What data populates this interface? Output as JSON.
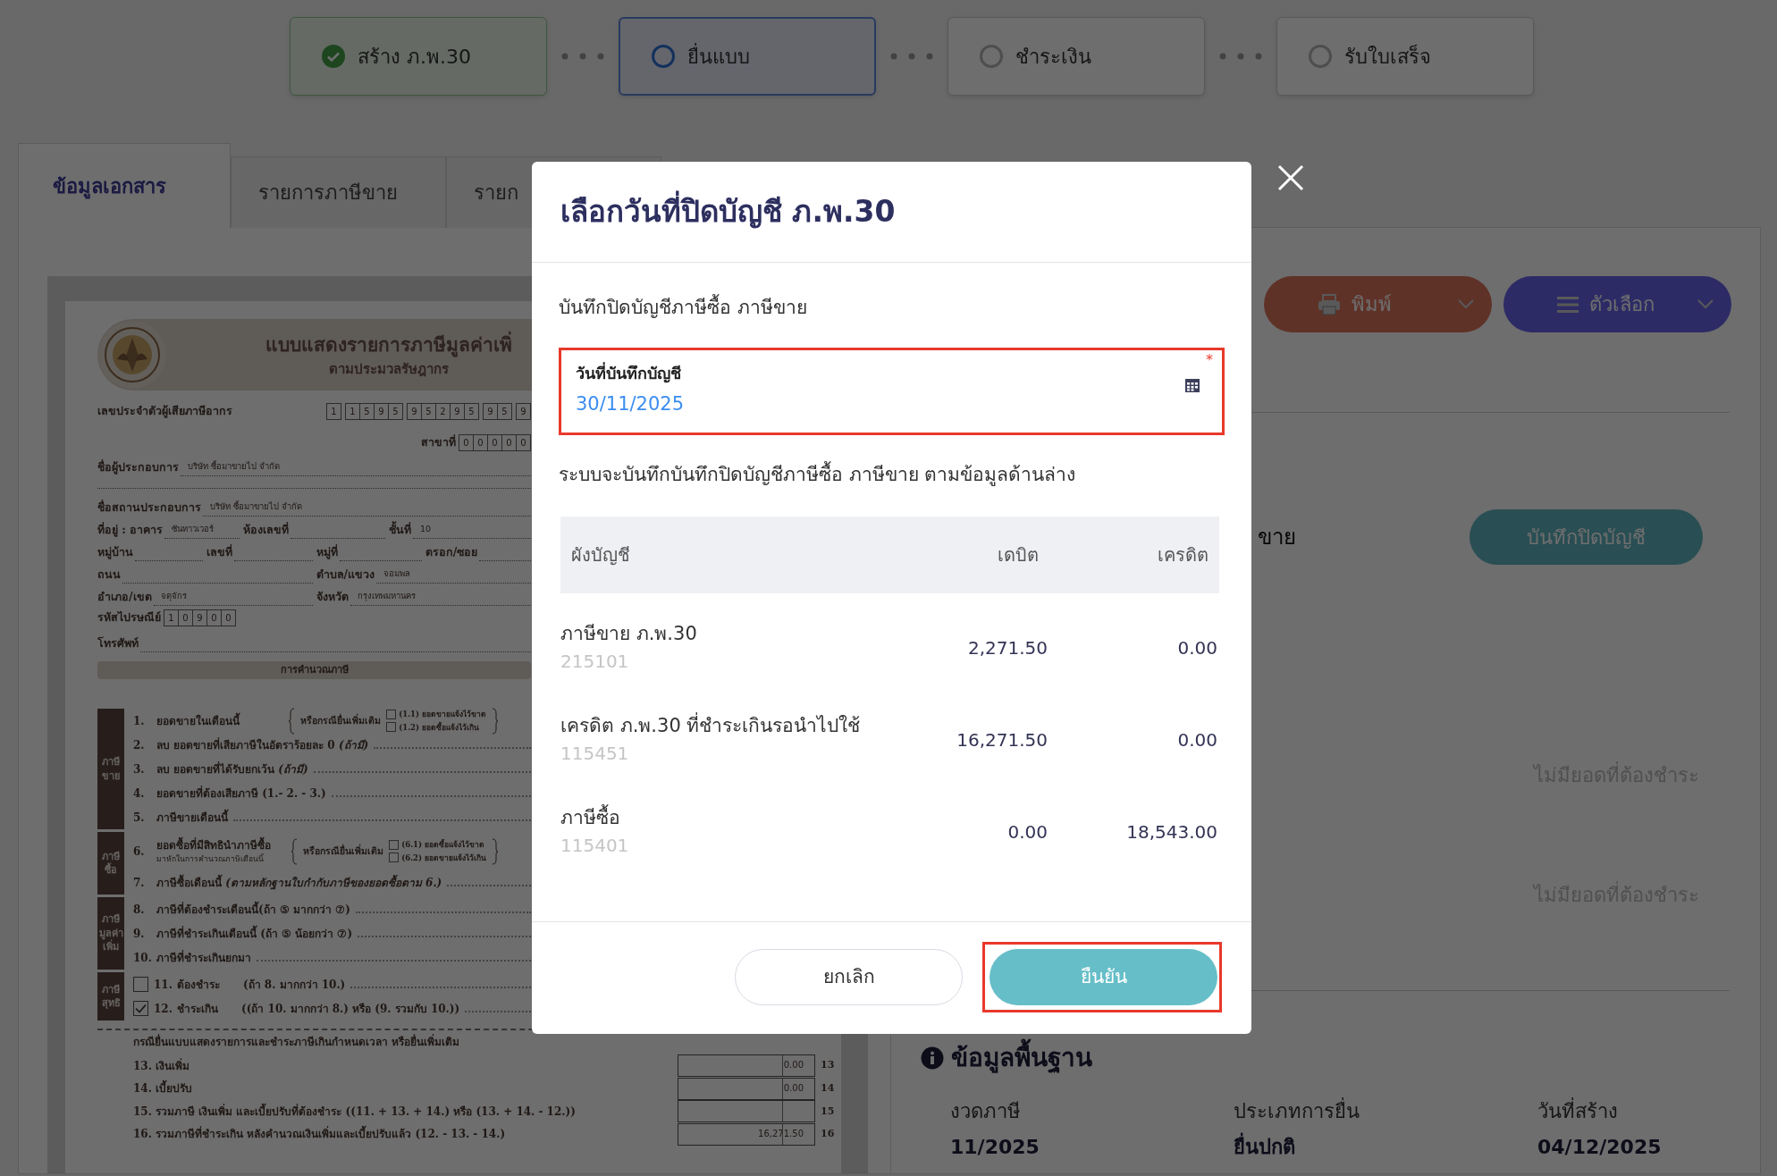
{
  "steps": [
    {
      "label": "สร้าง ภ.พ.30",
      "completed": true,
      "selected": false
    },
    {
      "label": "ยื่นแบบ",
      "completed": false,
      "selected": true
    },
    {
      "label": "ชำระเงิน",
      "completed": false,
      "selected": false
    },
    {
      "label": "รับใบเสร็จ",
      "completed": false,
      "selected": false
    }
  ],
  "tabs": [
    {
      "label": "ข้อมูลเอกสาร",
      "selected": true
    },
    {
      "label": "รายการภาษีขาย",
      "selected": false
    },
    {
      "label": "รายก",
      "selected": false
    }
  ],
  "document": {
    "title": "แบบแสดงรายการภาษีมูลค่าเพิ่",
    "subtitle": "ตามประมวลรัษฎากร",
    "tax_id": {
      "label": "เลขประจำตัวผู้เสียภาษีอากร",
      "groups": [
        [
          "1"
        ],
        [
          "1",
          "5",
          "9",
          "5"
        ],
        [
          "9",
          "5",
          "2",
          "9",
          "5"
        ],
        [
          "9",
          "5"
        ],
        [
          "9"
        ]
      ]
    },
    "branch": {
      "label": "สาขาที่",
      "digits": [
        "0",
        "0",
        "0",
        "0",
        "0"
      ]
    },
    "rows_1": [
      [
        {
          "label": "ชื่อผู้ประกอบการ",
          "value": "บริษัท ซื้อมาขายไป จำกัด"
        }
      ],
      [
        {
          "label": "ชื่อสถานประกอบการ",
          "value": "บริษัท ซื้อมาขายไป จำกัด"
        }
      ],
      [
        {
          "label": "ที่อยู่ : อาคาร",
          "value": "ซันทาวเวอร์"
        },
        {
          "label": "ห้องเลขที่"
        },
        {
          "label": "ชั้นที่",
          "value": "10"
        }
      ],
      [
        {
          "label": "หมู่บ้าน"
        },
        {
          "label": "เลขที่"
        },
        {
          "label": "หมู่ที่"
        },
        {
          "label": "ตรอก/ซอย"
        }
      ],
      [
        {
          "label": "ถนน"
        },
        {
          "label": "ตำบล/แขวง",
          "value": "จอมพล"
        }
      ],
      [
        {
          "label": "อำเภอ/เขต",
          "value": "จตุจักร"
        },
        {
          "label": "จังหวัด",
          "value": "กรุงเทพมหานคร"
        }
      ]
    ],
    "postcode": {
      "label": "รหัสไปรษณีย์",
      "digits": [
        "1",
        "0",
        "9",
        "0",
        "0"
      ]
    },
    "phone": {
      "label": "โทรศัพท์"
    },
    "section": "การคำนวณภาษี",
    "groups": [
      {
        "label": [
          "ภาษี",
          "ขาย"
        ],
        "items": [
          {
            "no": "1.",
            "text": "ยอดขายในเดือนนี้",
            "note": "หรือกรณียื่นเพิ่มเติม",
            "options": [
              {
                "label": "(1.1) ยอดขายแจ้งไว้ขาด",
                "checked": false
              },
              {
                "label": "(1.2) ยอดซื้อแจ้งไว้เกิน",
                "checked": false
              }
            ]
          },
          {
            "no": "2.",
            "text": "ลบ ยอดขายที่เสียภาษีในอัตราร้อยละ 0 *(ถ้ามี)*"
          },
          {
            "no": "3.",
            "text": "ลบ ยอดขายที่ได้รับยกเว้น *(ถ้ามี)*"
          },
          {
            "no": "4.",
            "text": "ยอดขายที่ต้องเสียภาษี (1.- 2. - 3.)"
          },
          {
            "no": "5.",
            "text": "ภาษีขายเดือนนี้"
          }
        ]
      },
      {
        "label": [
          "ภาษี",
          "ซื้อ"
        ],
        "items": [
          {
            "no": "6.",
            "text": "ยอดซื้อที่มีสิทธินำภาษีซื้อ",
            "subtext": "มาหักในการคำนวณภาษีเดือนนี้",
            "note": "หรือกรณียื่นเพิ่มเติม",
            "options": [
              {
                "label": "(6.1) ยอดซื้อแจ้งไว้ขาด",
                "checked": false
              },
              {
                "label": "(6.2) ยอดขายแจ้งไว้เกิน",
                "checked": false
              }
            ]
          },
          {
            "no": "7.",
            "text": "ภาษีซื้อเดือนนี้ *(ตามหลักฐานใบกำกับภาษีของยอดซื้อตาม 6.)*"
          }
        ]
      },
      {
        "label": [
          "ภาษี",
          "มูลค่า",
          "เพิ่ม"
        ],
        "items": [
          {
            "no": "8.",
            "text": "ภาษีที่ต้องชำระเดือนนี้(ถ้า ⑤ มากกว่า ⑦)"
          },
          {
            "no": "9.",
            "text": "ภาษีที่ชำระเกินเดือนนี้ (ถ้า ⑤ น้อยกว่า ⑦)"
          },
          {
            "no": "10.",
            "text": "ภาษีที่ชำระเกินยกมา"
          }
        ]
      },
      {
        "label": [
          "ภาษี",
          "สุทธิ"
        ],
        "items": [
          {
            "no": "11.",
            "text": "ต้องชำระ",
            "condition": "(ถ้า 8. มากกว่า 10.)",
            "kind": "check",
            "checked": false
          },
          {
            "no": "12.",
            "text": "ชำระเกิน",
            "condition": "((ถ้า 10. มากกว่า 8.) หรือ (9. รวมกับ 10.))",
            "kind": "check",
            "checked": true
          }
        ]
      }
    ],
    "late_title": "กรณียื่นแบบแสดงรายการและชำระภาษีเกินกำหนดเวลา หรือยื่นเพิ่มเติม",
    "late_items": [
      {
        "no": "13.",
        "text": "เงินเพิ่ม",
        "amount": "0.00",
        "box_no": "13",
        "kind": "sub"
      },
      {
        "no": "14.",
        "text": "เบี้ยปรับ",
        "amount": "0.00",
        "box_no": "14",
        "kind": "sub"
      },
      {
        "no": "15.",
        "text": "รวมภาษี เงินเพิ่ม และเบี้ยปรับที่ต้องชำระ ((11. + 13. + 14.) หรือ (13. + 14. - 12.))",
        "box_no": "15",
        "kind": "total"
      },
      {
        "no": "16.",
        "text": "รวมภาษีที่ชำระเกิน หลังคำนวณเงินเพิ่มและเบี้ยปรับแล้ว (12. - 13. - 14.)",
        "amount": "16,271.50",
        "box_no": "16",
        "kind": "total"
      }
    ]
  },
  "side_panel": {
    "buttons": [
      {
        "label": "พิมพ์",
        "kind": "print"
      },
      {
        "label": "ตัวเลือก",
        "kind": "menu"
      }
    ],
    "label_1": "ขาย",
    "action_button": "บันทึกปิดบัญชี",
    "notes": [
      "ไม่มียอดที่ต้องชำระ",
      "ไม่มียอดที่ต้องชำระ"
    ],
    "info": {
      "title": "ข้อมูลพื้นฐาน",
      "fields": [
        {
          "label": "งวดภาษี",
          "value": "11/2025"
        },
        {
          "label": "ประเภทการยื่น",
          "value": "ยื่นปกติ"
        },
        {
          "label": "วันที่สร้าง",
          "value": "04/12/2025"
        }
      ]
    }
  },
  "dialog": {
    "title": "เลือกวันที่ปิดบัญชี ภ.พ.30",
    "subtitle": "บันทึกปิดบัญชีภาษีซื้อ ภาษีขาย",
    "date_field": {
      "label": "วันที่บันทึกบัญชี",
      "value": "30/11/2025",
      "required_mark": "*",
      "highlighted": true
    },
    "description": "ระบบจะบันทึกบันทึกปิดบัญชีภาษีซื้อ ภาษีขาย ตามข้อมูลด้านล่าง",
    "table": {
      "columns": [
        "ผังบัญชี",
        "เดบิต",
        "เครดิต"
      ],
      "rows": [
        {
          "account": "ภาษีขาย ภ.พ.30",
          "code": "215101",
          "debit": "2,271.50",
          "credit": "0.00"
        },
        {
          "account": "เครดิต ภ.พ.30 ที่ชำระเกินรอนำไปใช้",
          "code": "115451",
          "debit": "16,271.50",
          "credit": "0.00"
        },
        {
          "account": "ภาษีซื้อ",
          "code": "115401",
          "debit": "0.00",
          "credit": "18,543.00"
        }
      ]
    },
    "buttons": [
      {
        "label": "ยกเลิก",
        "kind": "cancel",
        "highlighted": false
      },
      {
        "label": "ยืนยัน",
        "kind": "confirm",
        "highlighted": true
      }
    ]
  }
}
